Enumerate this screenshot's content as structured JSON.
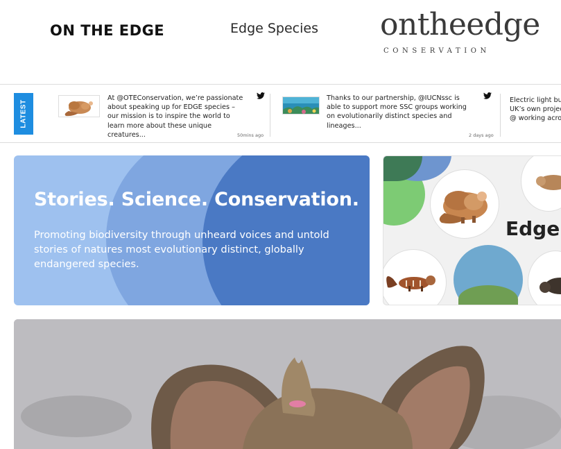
{
  "header": {
    "logo_left": "ON THE EDGE",
    "nav_link": "Edge Species",
    "logo_right_word": "ontheedge",
    "logo_right_sub": "CONSERVATION"
  },
  "ticker": {
    "label": "LATEST",
    "items": [
      {
        "text": "At @OTEConservation, we’re passionate about speaking up for EDGE species – our mission is to inspire the world to learn more about these unique creatures...",
        "time": "50mins ago",
        "thumb_icon": "pangolin-image",
        "platform_icon": "twitter-icon"
      },
      {
        "text": "Thanks to our partnership, @IUCNssc is able to support more SSC groups working on evolutionarily distinct species and lineages...",
        "time": "2 days ago",
        "thumb_icon": "coral-reef-image",
        "platform_icon": "twitter-icon"
      },
      {
        "text": "Electric light bul of the UK’s own project led by @ working across #",
        "time": "",
        "platform_icon": "twitter-icon"
      }
    ]
  },
  "hero": {
    "title": "Stories. Science. Conservation.",
    "body": "Promoting biodiversity through unheard voices and untold stories of natures most evolutionary distinct, globally endangered species.",
    "colors": {
      "light": "#9ec1ef",
      "mid": "#7fa6e0",
      "dark": "#4a79c4"
    }
  },
  "species_card": {
    "title": "Edge S"
  }
}
